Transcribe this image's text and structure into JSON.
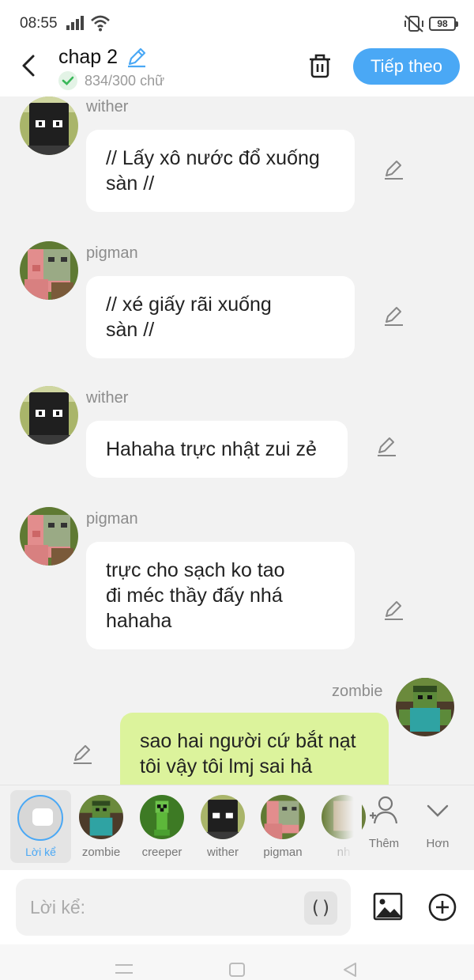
{
  "status": {
    "time": "08:55",
    "battery": "98"
  },
  "header": {
    "title": "chap 2",
    "word_count": "834/300 chữ",
    "next_label": "Tiếp theo"
  },
  "messages": [
    {
      "name": "wither",
      "text": "// Lấy xô nước đổ xuống\nsàn //",
      "side": "left",
      "avatar": "wither-avatar"
    },
    {
      "name": "pigman",
      "text": "// xé giấy rãi xuống\nsàn //",
      "side": "left",
      "avatar": "pigman-avatar"
    },
    {
      "name": "wither",
      "text": "Hahaha trực nhật zui zẻ",
      "side": "left",
      "avatar": "wither-avatar"
    },
    {
      "name": "pigman",
      "text": "trực cho sạch ko tao\nđi méc thầy đấy nhá\nhahaha",
      "side": "left",
      "avatar": "pigman-avatar"
    },
    {
      "name": "zombie",
      "text": "sao hai người cứ bắt nạt\ntôi vậy tôi lmj sai hả",
      "side": "right",
      "avatar": "zombie-avatar"
    }
  ],
  "characters": {
    "narrator": "Lời kể",
    "list": [
      "zombie",
      "creeper",
      "wither",
      "pigman",
      "nh"
    ],
    "add_label": "Thêm",
    "more_label": "Hơn"
  },
  "input": {
    "placeholder": "Lời kể:",
    "paren": "()"
  },
  "colors": {
    "accent": "#4aa8f5",
    "right_bubble": "#dcf39c",
    "left_bubble": "#ffffff"
  }
}
